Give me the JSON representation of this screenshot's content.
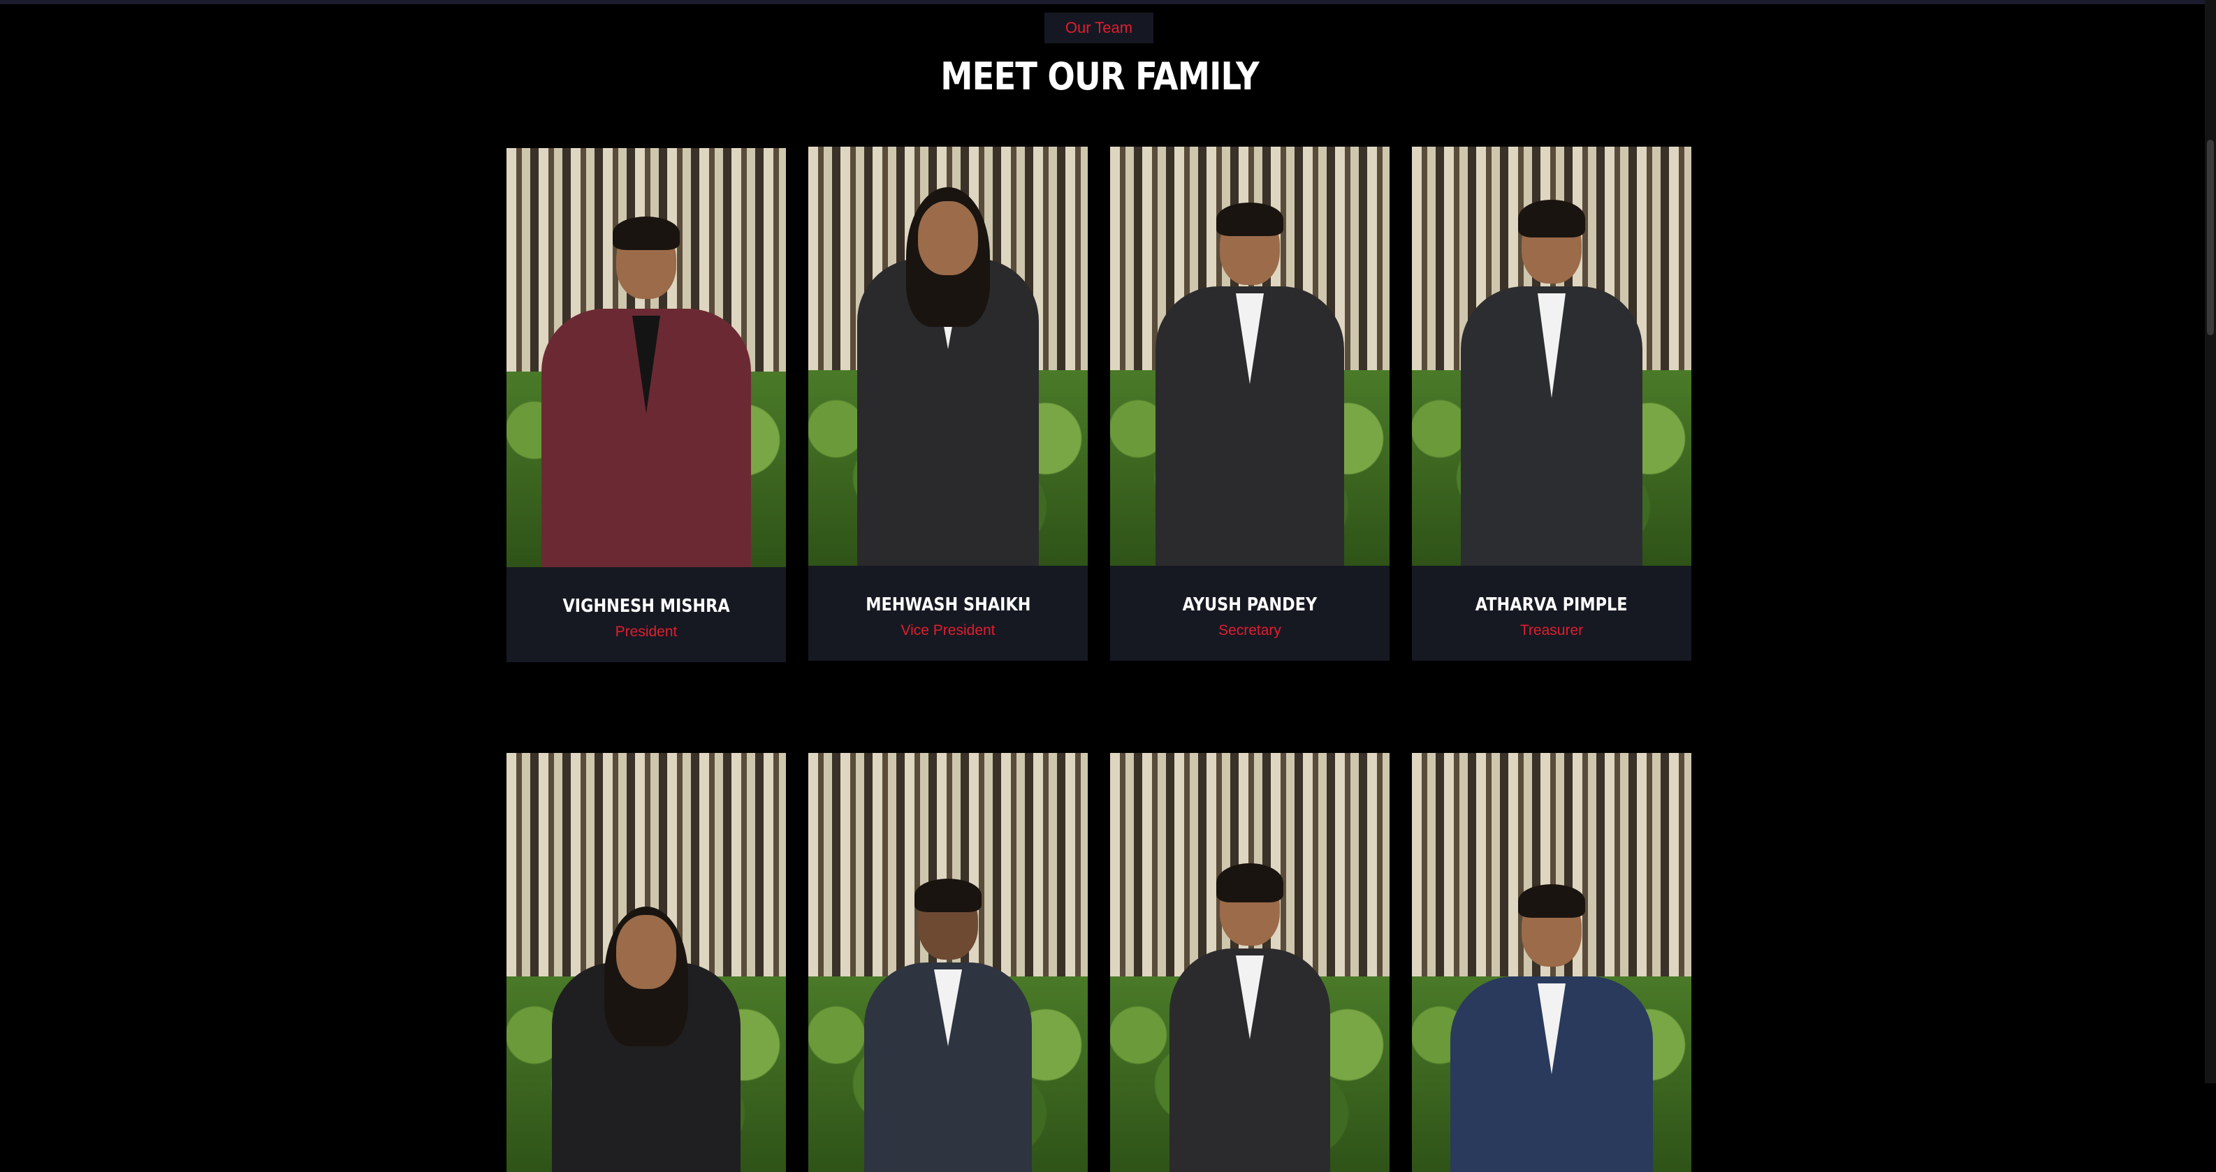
{
  "section": {
    "badge": "Our Team",
    "title": "MEET OUR FAMILY"
  },
  "colors": {
    "accent": "#e11d2f",
    "background": "#000000",
    "card": "#161922"
  },
  "members": [
    {
      "name": "VIGHNESH MISHRA",
      "role": "President"
    },
    {
      "name": "MEHWASH SHAIKH",
      "role": "Vice President"
    },
    {
      "name": "AYUSH PANDEY",
      "role": "Secretary"
    },
    {
      "name": "ATHARVA PIMPLE",
      "role": "Treasurer"
    }
  ]
}
